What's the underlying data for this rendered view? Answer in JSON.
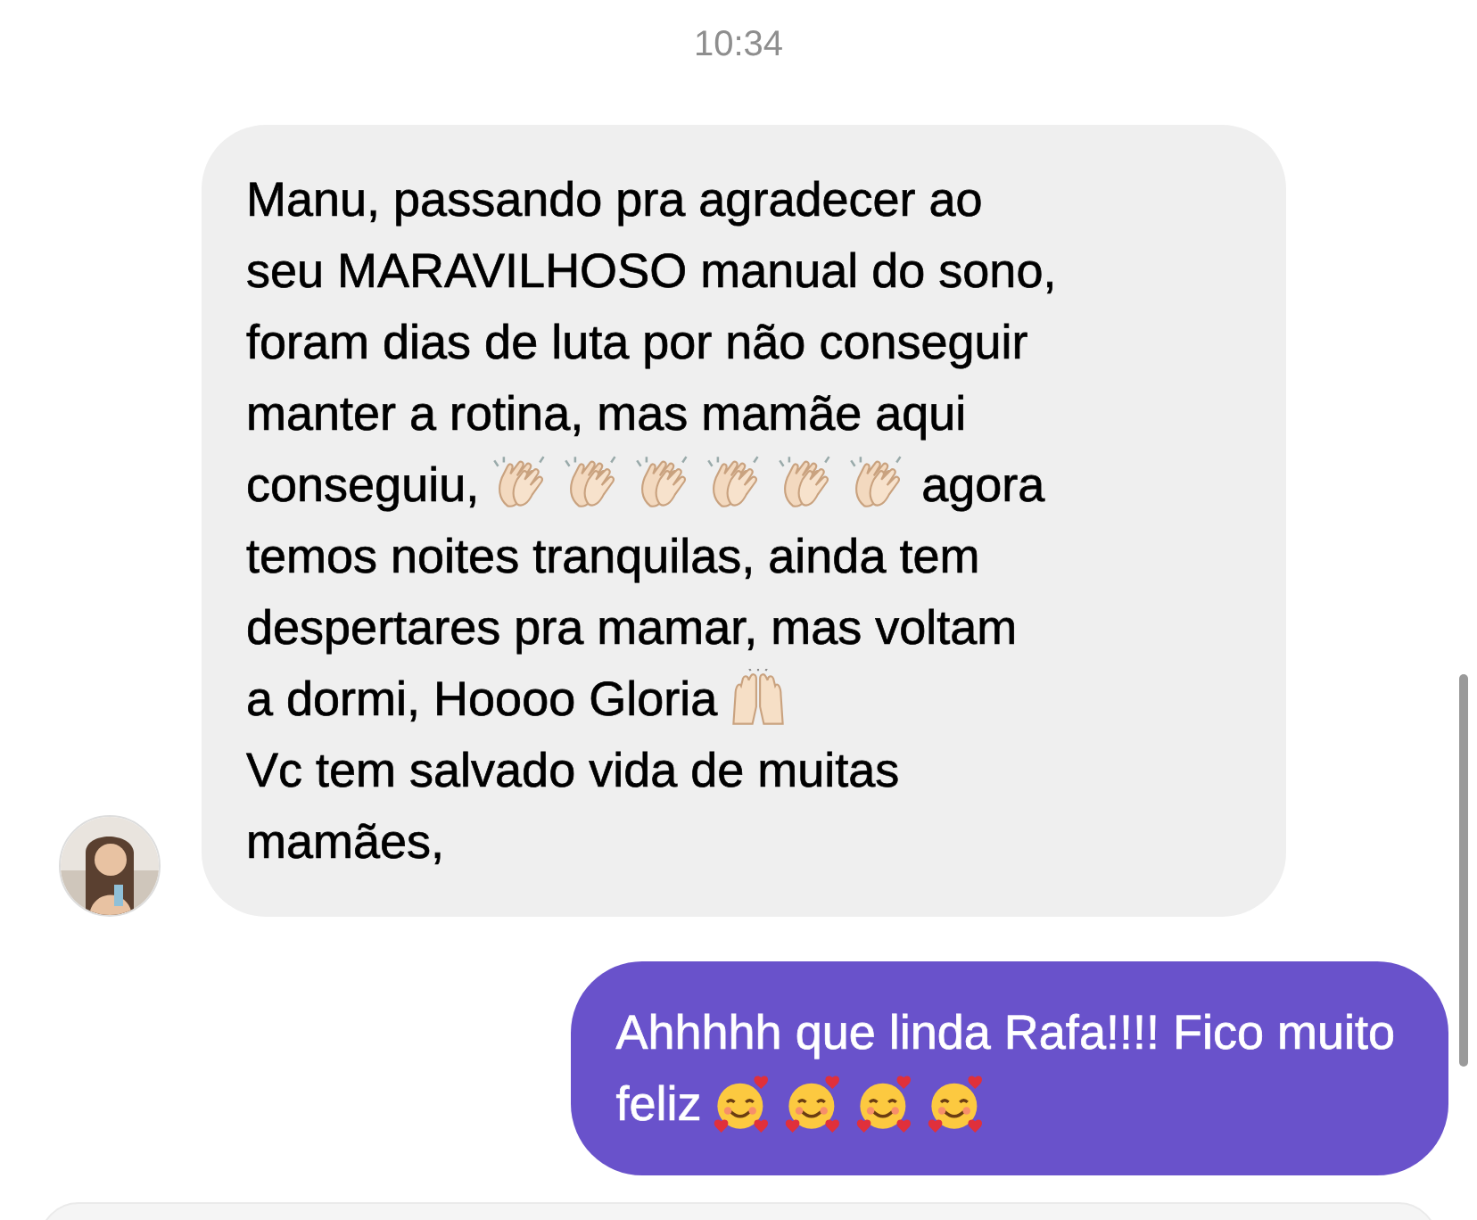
{
  "timestamp": "10:34",
  "messages": [
    {
      "kind": "received",
      "lines": [
        [
          {
            "kind": "text",
            "text": "Manu, passando pra agradecer ao"
          }
        ],
        [
          {
            "kind": "text",
            "text": "seu MARAVILHOSO manual do sono,"
          }
        ],
        [
          {
            "kind": "text",
            "text": "foram dias de luta por não conseguir"
          }
        ],
        [
          {
            "kind": "text",
            "text": "manter a rotina, mas mamãe aqui"
          }
        ],
        [
          {
            "kind": "text",
            "text": "conseguiu,"
          },
          {
            "kind": "clap"
          },
          {
            "kind": "clap"
          },
          {
            "kind": "clap"
          },
          {
            "kind": "clap"
          },
          {
            "kind": "clap"
          },
          {
            "kind": "clap"
          },
          {
            "kind": "text",
            "text": "agora"
          }
        ],
        [
          {
            "kind": "text",
            "text": "temos noites tranquilas, ainda tem"
          }
        ],
        [
          {
            "kind": "text",
            "text": "despertares pra mamar, mas voltam"
          }
        ],
        [
          {
            "kind": "text",
            "text": "a dormi, Hoooo Gloria"
          },
          {
            "kind": "raised"
          }
        ],
        [
          {
            "kind": "text",
            "text": "Vc tem salvado vida de muitas"
          }
        ],
        [
          {
            "kind": "text",
            "text": "mamães,"
          }
        ]
      ]
    },
    {
      "kind": "sent",
      "lines": [
        [
          {
            "kind": "text",
            "text": "Ahhhhh que linda Rafa!!!! Fico muito"
          }
        ],
        [
          {
            "kind": "text",
            "text": "feliz"
          },
          {
            "kind": "hearts"
          },
          {
            "kind": "hearts"
          },
          {
            "kind": "hearts"
          },
          {
            "kind": "hearts"
          }
        ]
      ]
    }
  ]
}
